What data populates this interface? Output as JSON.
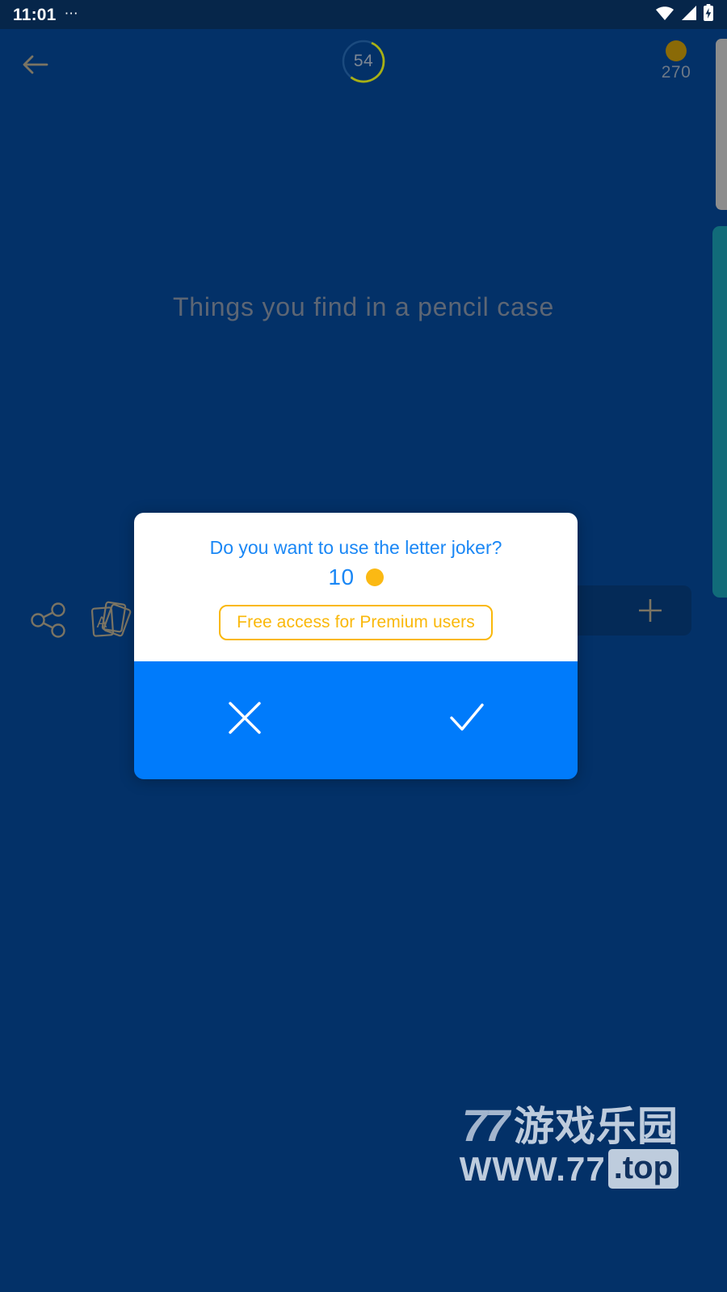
{
  "status_bar": {
    "time": "11:01",
    "notification_dots": "⋯",
    "icons": [
      "wifi-icon",
      "cellular-signal-icon",
      "battery-charging-icon"
    ]
  },
  "top_bar": {
    "back_icon": "back-arrow-icon",
    "level_number": "54",
    "level_progress_percent": 54,
    "coin_icon": "coin-icon",
    "coin_count": "270"
  },
  "puzzle": {
    "title": "Things you find in a pencil case"
  },
  "toolbar": {
    "share_icon": "share-icon",
    "letter_joker_icon": "letter-cards-icon",
    "add_icon": "plus-icon",
    "answer_placeholder": ""
  },
  "dialog": {
    "question": "Do you want to use the letter joker?",
    "cost_amount": "10",
    "cost_coin_icon": "coin-icon",
    "premium_label": "Free access for Premium users",
    "decline_icon": "close-x-icon",
    "confirm_icon": "check-icon"
  },
  "watermark": {
    "logo_digits": "77",
    "logo_cn": "游戏乐园",
    "url_main": "WWW.77",
    "url_tld": ".top"
  },
  "colors": {
    "status_bar_bg": "#06264a",
    "app_bg": "#033168",
    "dialog_white": "#ffffff",
    "action_blue": "#007bfb",
    "text_blue": "#1a87f5",
    "gold": "#fab80a",
    "coin_gold": "#fbb913",
    "muted_text": "#5d6674"
  }
}
